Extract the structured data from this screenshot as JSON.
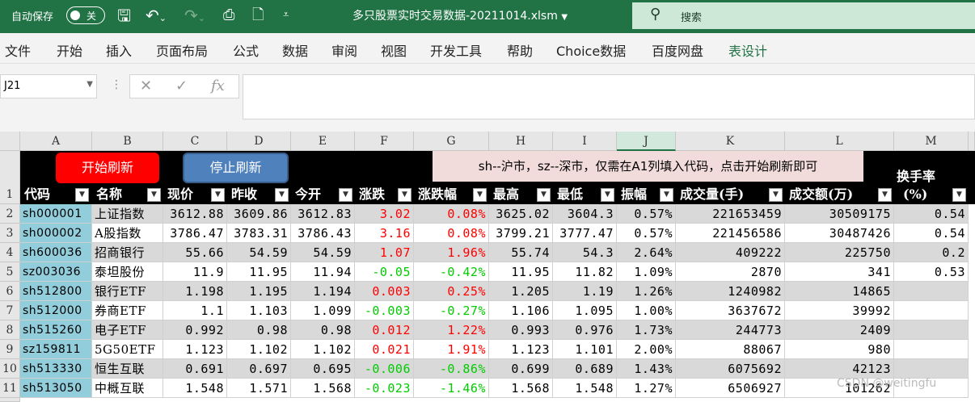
{
  "titlebar": {
    "autosave_label": "自动保存",
    "toggle_state": "关",
    "doc_title": "多只股票实时交易数据-20211014.xlsm",
    "search_placeholder": "搜索"
  },
  "ribbon_tabs": [
    "文件",
    "开始",
    "插入",
    "页面布局",
    "公式",
    "数据",
    "审阅",
    "视图",
    "开发工具",
    "帮助",
    "Choice数据",
    "百度网盘",
    "表设计"
  ],
  "active_tab": "表设计",
  "formula_bar": {
    "name_box": "J21",
    "fx": "fx",
    "content": ""
  },
  "columns": [
    "A",
    "B",
    "C",
    "D",
    "E",
    "F",
    "G",
    "H",
    "I",
    "J",
    "K",
    "L",
    "M"
  ],
  "row_numbers": [
    "1",
    "2",
    "3",
    "4",
    "5",
    "6",
    "7",
    "8",
    "9",
    "10",
    "11"
  ],
  "buttons": {
    "start": "开始刷新",
    "stop": "停止刷新"
  },
  "note": "sh--沪市，sz--深市，仅需在A1列填入代码，点击开始刷新即可",
  "headers": [
    "代码",
    "名称",
    "现价",
    "昨收",
    "今开",
    "涨跌",
    "涨跌幅",
    "最高",
    "最低",
    "振幅",
    "成交量(手)",
    "成交额(万)",
    "换手率",
    "(%)"
  ],
  "rows": [
    [
      "sh000001",
      "上证指数",
      "3612.88",
      "3609.86",
      "3612.83",
      "3.02",
      "0.08%",
      "3625.02",
      "3604.3",
      "0.57%",
      "221653459",
      "30509175",
      "0.54"
    ],
    [
      "sh000002",
      "A股指数",
      "3786.47",
      "3783.31",
      "3786.43",
      "3.16",
      "0.08%",
      "3799.21",
      "3777.47",
      "0.57%",
      "221456586",
      "30487426",
      "0.54"
    ],
    [
      "sh600036",
      "招商银行",
      "55.66",
      "54.59",
      "54.59",
      "1.07",
      "1.96%",
      "55.74",
      "54.3",
      "2.64%",
      "409222",
      "225750",
      "0.2"
    ],
    [
      "sz003036",
      "泰坦股份",
      "11.9",
      "11.95",
      "11.94",
      "-0.05",
      "-0.42%",
      "11.95",
      "11.82",
      "1.09%",
      "2870",
      "341",
      "0.53"
    ],
    [
      "sh512800",
      "银行ETF",
      "1.198",
      "1.195",
      "1.194",
      "0.003",
      "0.25%",
      "1.205",
      "1.19",
      "1.26%",
      "1240982",
      "14865",
      ""
    ],
    [
      "sh512000",
      "券商ETF",
      "1.1",
      "1.103",
      "1.099",
      "-0.003",
      "-0.27%",
      "1.106",
      "1.095",
      "1.00%",
      "3637672",
      "39992",
      ""
    ],
    [
      "sh515260",
      "电子ETF",
      "0.992",
      "0.98",
      "0.98",
      "0.012",
      "1.22%",
      "0.993",
      "0.976",
      "1.73%",
      "244773",
      "2409",
      ""
    ],
    [
      "sz159811",
      "5G50ETF",
      "1.123",
      "1.102",
      "1.102",
      "0.021",
      "1.91%",
      "1.123",
      "1.101",
      "2.00%",
      "88067",
      "980",
      ""
    ],
    [
      "sh513330",
      "恒生互联",
      "0.691",
      "0.697",
      "0.695",
      "-0.006",
      "-0.86%",
      "0.699",
      "0.689",
      "1.43%",
      "6075692",
      "42123",
      ""
    ],
    [
      "sh513050",
      "中概互联",
      "1.548",
      "1.571",
      "1.568",
      "-0.023",
      "-1.46%",
      "1.568",
      "1.548",
      "1.27%",
      "6506927",
      "101262",
      ""
    ]
  ],
  "watermark": "CSDN @weitingfu",
  "colors": {
    "excel_green": "#217346",
    "code_fill": "#92cddc",
    "up": "#ff0000",
    "down": "#00cc00"
  }
}
